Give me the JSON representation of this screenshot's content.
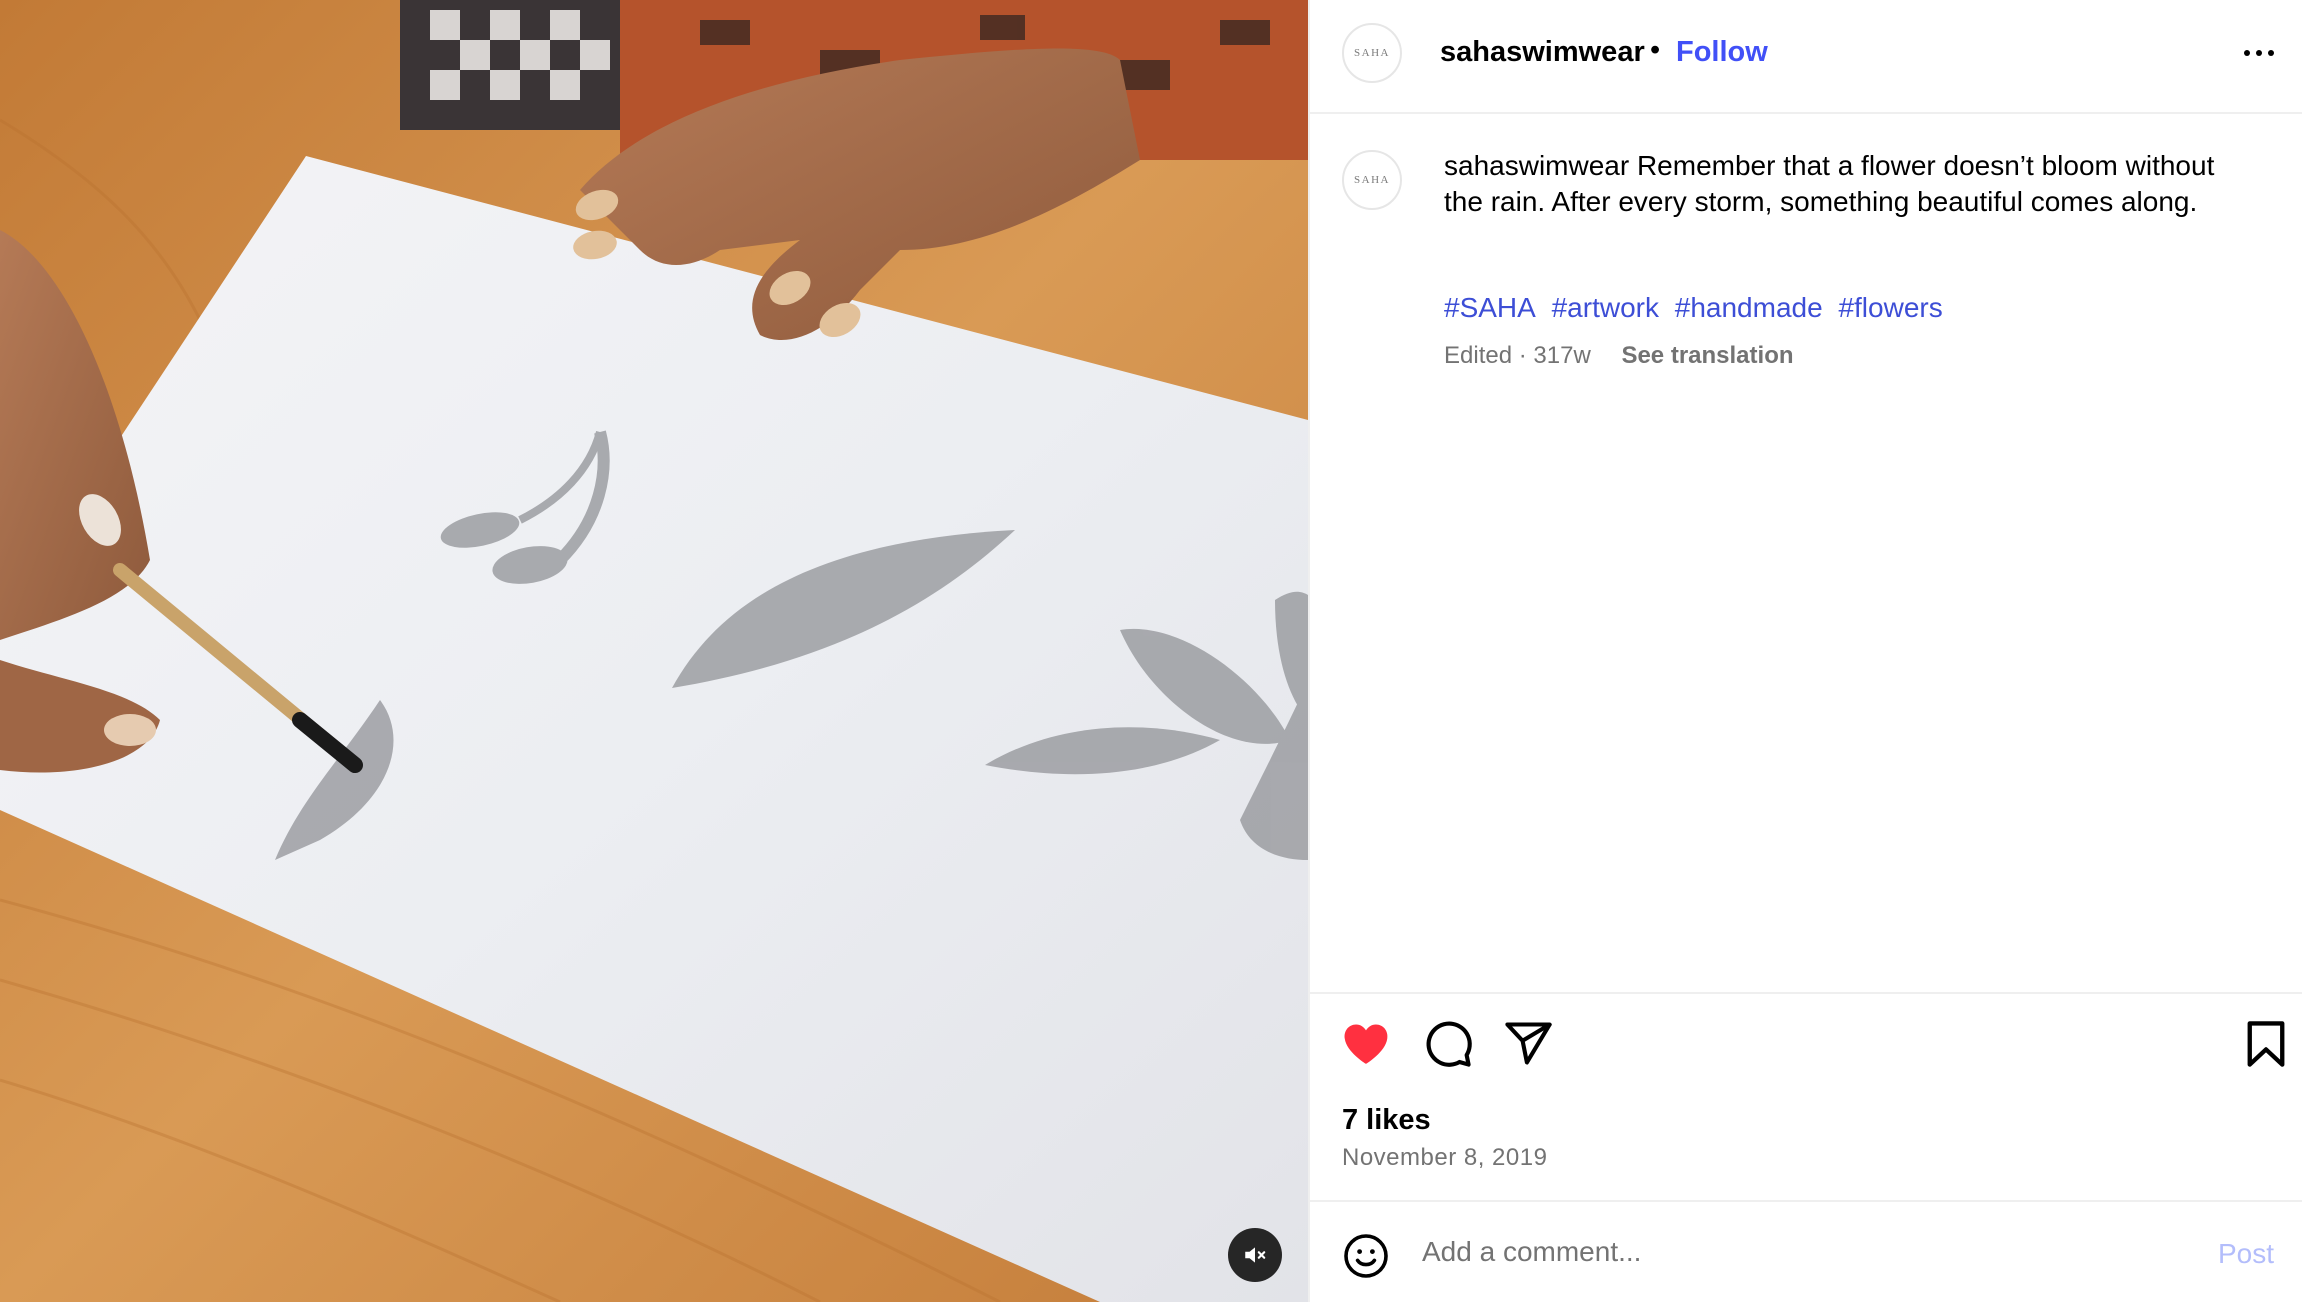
{
  "post": {
    "username": "sahaswimwear",
    "avatar_text": "SAHA",
    "follow_label": "Follow",
    "separator": "•",
    "more_icon": "more-horizontal-icon"
  },
  "caption": {
    "username": "sahaswimwear",
    "text": "Remember that a flower doesn’t bloom without the rain. After every storm, something beautiful comes along.",
    "hashtags": [
      "#SAHA",
      "#artwork",
      "#handmade",
      "#flowers"
    ],
    "edited_label": "Edited",
    "meta_separator": "·",
    "age": "317w",
    "see_translation": "See translation"
  },
  "actions": {
    "like_icon": "heart-filled-icon",
    "comment_icon": "comment-icon",
    "share_icon": "send-icon",
    "save_icon": "bookmark-icon",
    "liked": true,
    "like_color": "#ff3040"
  },
  "stats": {
    "likes": "7 likes",
    "date": "November 8, 2019"
  },
  "comment_box": {
    "emoji_icon": "emoji-icon",
    "placeholder": "Add a comment...",
    "post_label": "Post"
  },
  "media": {
    "type": "video",
    "mute_icon": "speaker-muted-icon"
  },
  "colors": {
    "link": "#4150f7",
    "hashtag": "#3d4ed6",
    "muted_text": "#737373",
    "post_disabled": "#b3bdfb"
  }
}
